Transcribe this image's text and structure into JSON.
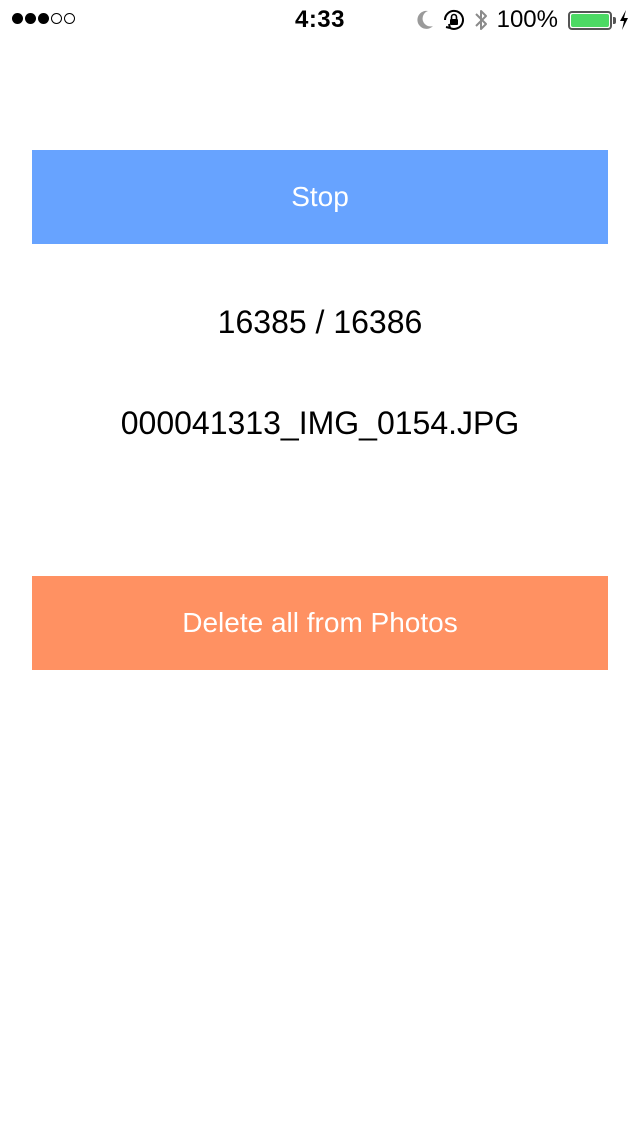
{
  "status_bar": {
    "signal_filled": 3,
    "signal_empty": 2,
    "time": "4:33",
    "battery_percent": "100%",
    "battery_level": 1.0,
    "battery_color": "#4cd964",
    "icons": [
      "moon-icon",
      "orientation-lock-icon",
      "bluetooth-icon",
      "battery-icon",
      "charging-bolt-icon"
    ]
  },
  "main": {
    "stop_label": "Stop",
    "stop_color": "#67a3ff",
    "progress_text": "16385 / 16386",
    "filename": "000041313_IMG_0154.JPG",
    "delete_label": "Delete all from Photos",
    "delete_color": "#ff9162"
  }
}
